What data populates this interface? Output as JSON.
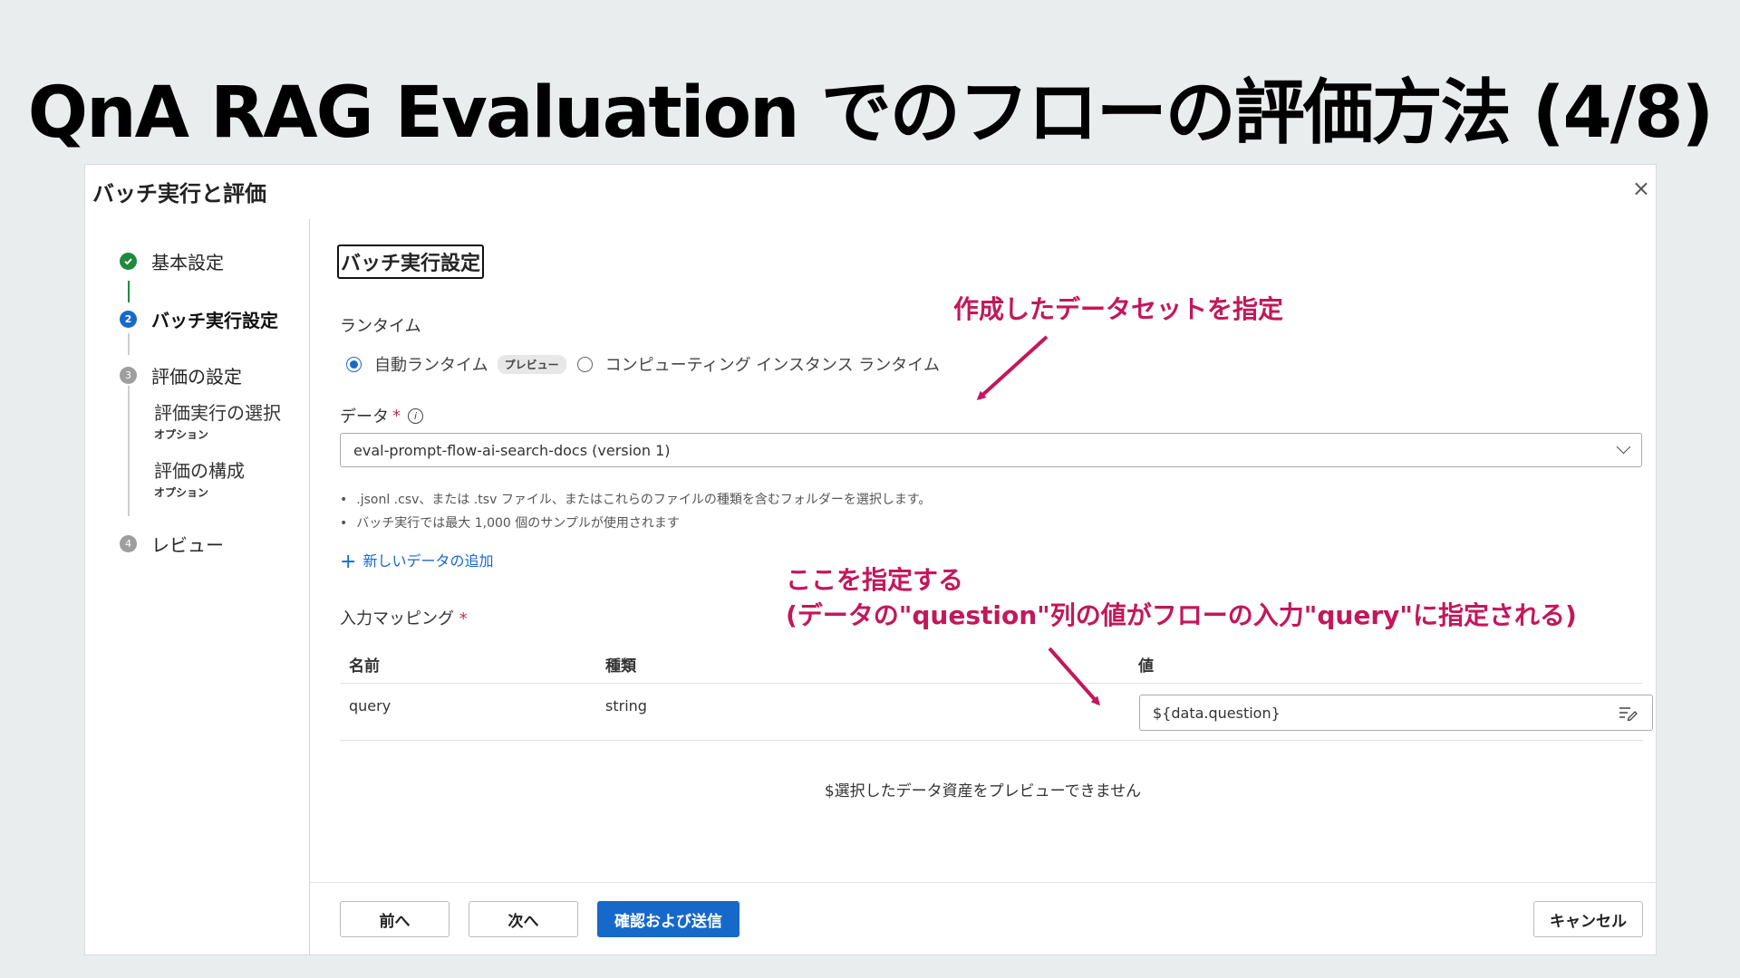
{
  "slide_title": "QnA RAG Evaluation でのフローの評価方法 (4/8)",
  "dialog": {
    "title": "バッチ実行と評価",
    "close_glyph": "×"
  },
  "steps": {
    "basic": "基本設定",
    "batch": "バッチ実行設定",
    "eval": "評価の設定",
    "eval_run": "評価実行の選択",
    "eval_run_opt": "オプション",
    "eval_config": "評価の構成",
    "eval_config_opt": "オプション",
    "review": "レビュー",
    "num_2": "2",
    "num_3": "3",
    "num_4": "4"
  },
  "main": {
    "section_title": "バッチ実行設定",
    "runtime_label": "ランタイム",
    "runtime_auto": "自動ランタイム",
    "runtime_badge": "プレビュー",
    "runtime_compute": "コンピューティング インスタンス ランタイム",
    "data_label": "データ",
    "required_mark": "*",
    "data_selected": "eval-prompt-flow-ai-search-docs (version 1)",
    "hint_1": ".jsonl .csv、または .tsv ファイル、またはこれらのファイルの種類を含むフォルダーを選択します。",
    "hint_2": "バッチ実行では最大 1,000 個のサンプルが使用されます",
    "add_data": "新しいデータの追加",
    "mapping_label": "入力マッピング",
    "col_name": "名前",
    "col_type": "種類",
    "col_value": "値",
    "row_name": "query",
    "row_type": "string",
    "row_value": "${data.question}",
    "preview_msg": "$選択したデータ資産をプレビューできません"
  },
  "buttons": {
    "prev": "前へ",
    "next": "次へ",
    "submit": "確認および送信",
    "cancel": "キャンセル"
  },
  "annotations": {
    "dataset": "作成したデータセットを指定",
    "mapping_line1": "ここを指定する",
    "mapping_line2": "(データの\"question\"列の値がフローの入力\"query\"に指定される)"
  },
  "colors": {
    "accent": "#1769c9",
    "annotation": "#c2185b",
    "done": "#1f8a3c"
  }
}
